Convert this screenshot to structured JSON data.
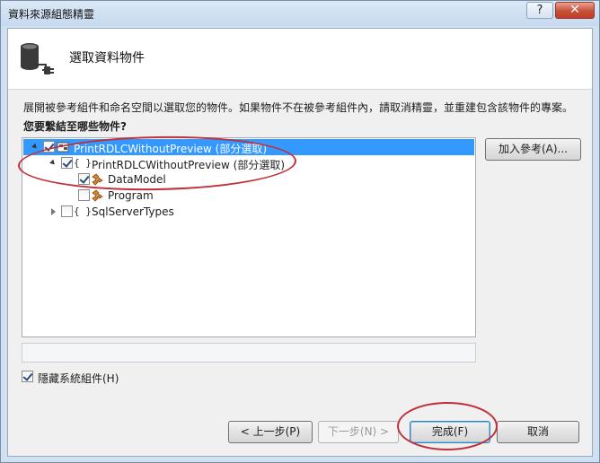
{
  "window": {
    "title": "資料來源組態精靈",
    "help_label": "?",
    "close_label": "✕"
  },
  "header": {
    "title": "選取資料物件",
    "icon": "database-plug-icon"
  },
  "description": "展開被參考組件和命名空間以選取您的物件。如果物件不在被參考組件內，請取消精靈，並重建包含該物件的專案。",
  "question": "您要繫結至哪些物件?",
  "tree": {
    "items": [
      {
        "label": "PrintRDLCWithoutPreview (部分選取)",
        "icon": "assembly-icon",
        "expanded": true,
        "checked": true,
        "selected": true
      },
      {
        "label": "PrintRDLCWithoutPreview (部分選取)",
        "icon": "namespace-icon",
        "expanded": true,
        "checked": true,
        "selected": false
      },
      {
        "label": "DataModel",
        "icon": "class-icon",
        "checked": true,
        "selected": false
      },
      {
        "label": "Program",
        "icon": "class-icon",
        "checked": false,
        "selected": false
      },
      {
        "label": "SqlServerTypes",
        "icon": "namespace-icon",
        "expanded": false,
        "checked": false,
        "selected": false
      }
    ]
  },
  "add_reference_label": "加入參考(A)...",
  "hide_system_label": "隱藏系統組件(H)",
  "hide_system_checked": true,
  "buttons": {
    "prev": "< 上一步(P)",
    "next": "下一步(N) >",
    "finish": "完成(F)",
    "cancel": "取消"
  },
  "namespace_glyph": "{ }",
  "colors": {
    "selection": "#3399ff",
    "annotation": "#c0303a",
    "close_button": "#c8503a"
  }
}
